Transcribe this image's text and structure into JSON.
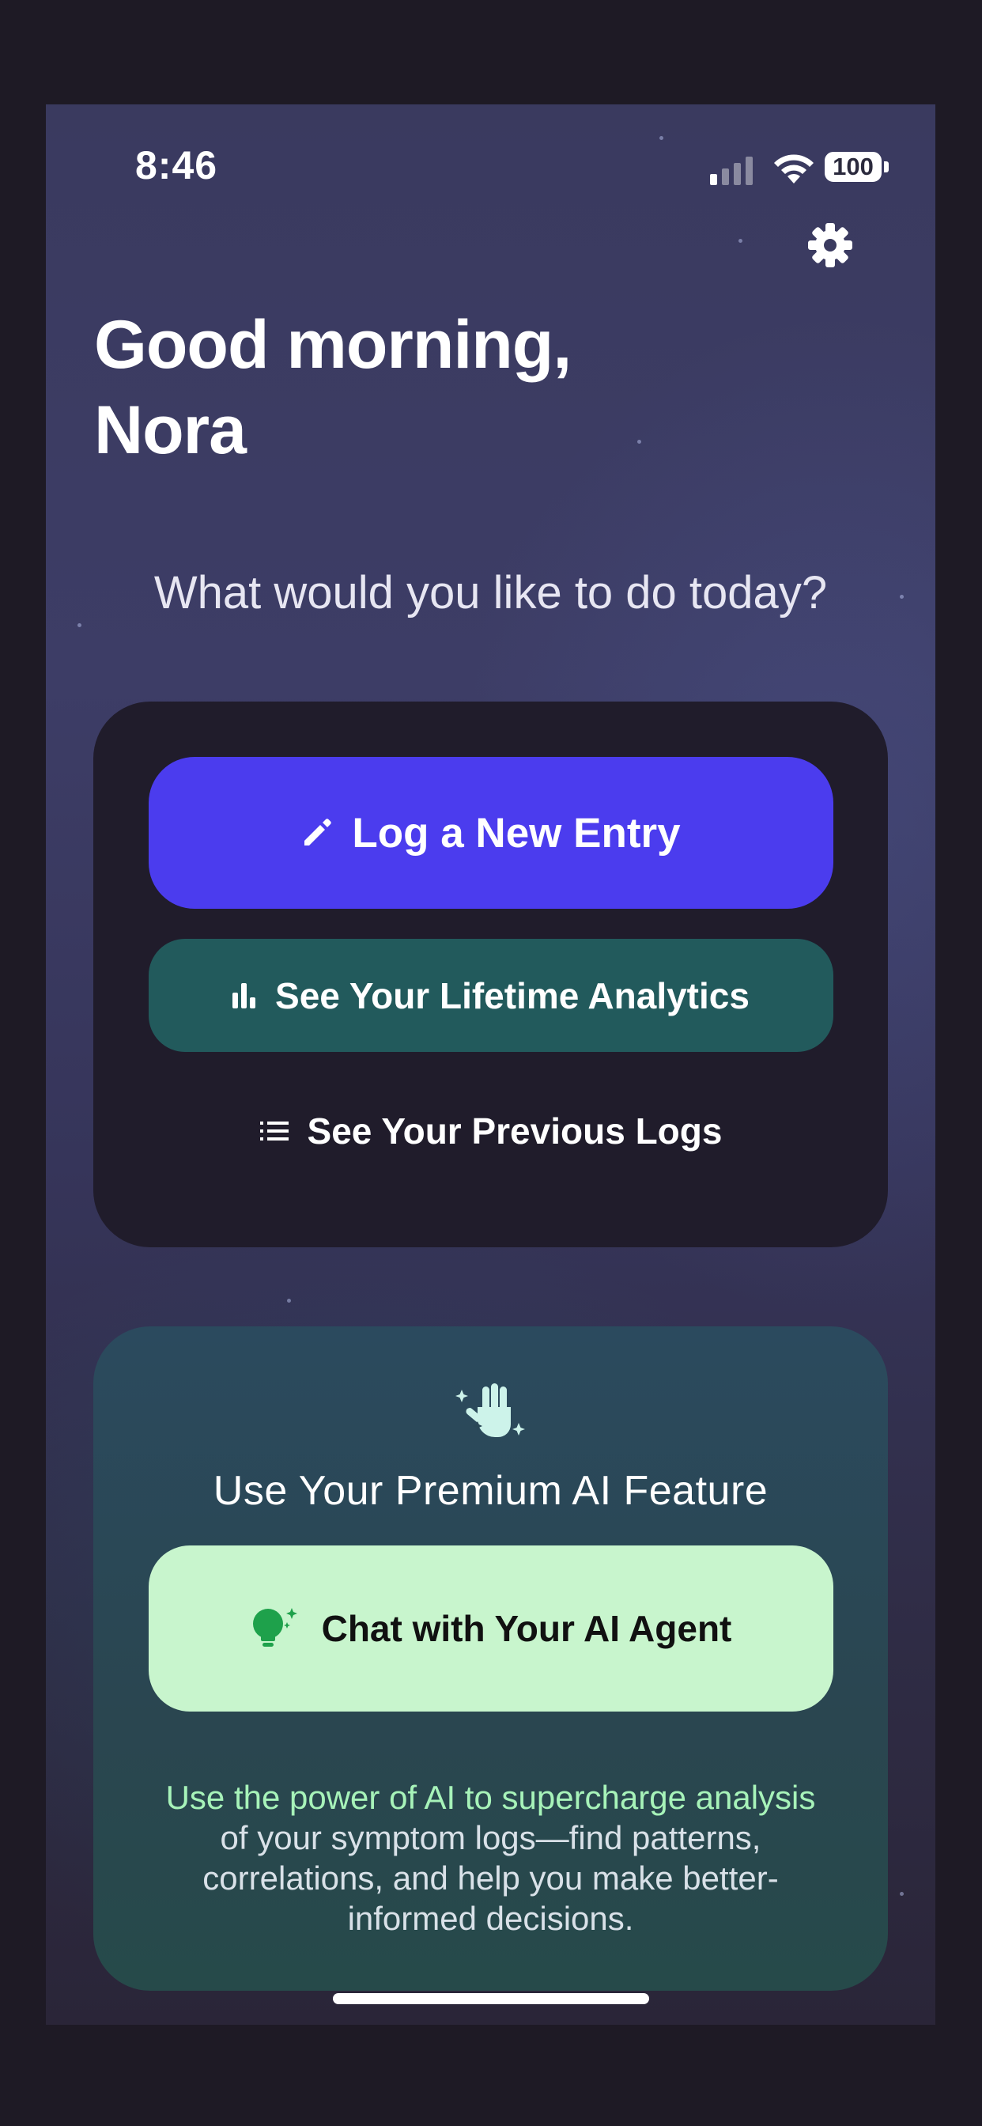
{
  "status_bar": {
    "time": "8:46",
    "battery": "100",
    "icons": [
      "cellular-signal-icon",
      "wifi-icon",
      "battery-icon"
    ]
  },
  "header": {
    "settings_icon": "gear-icon",
    "greeting_line1": "Good morning,",
    "greeting_line2": "Nora",
    "prompt": "What would you like to do today?"
  },
  "actions": {
    "log_entry": {
      "label": "Log a New Entry",
      "icon": "pencil-icon"
    },
    "analytics": {
      "label": "See Your Lifetime Analytics",
      "icon": "bar-chart-icon"
    },
    "previous_logs": {
      "label": "See Your Previous Logs",
      "icon": "list-icon"
    }
  },
  "ai_feature": {
    "icon": "sparkle-hand-icon",
    "title": "Use Your Premium AI Feature",
    "chat_button": {
      "label": "Chat with Your AI Agent",
      "icon": "lightbulb-sparkle-icon"
    },
    "description_highlight": "Use the power of AI to supercharge analysis",
    "description_rest": "of your symptom logs—find patterns, correlations, and help you make better-informed decisions."
  },
  "colors": {
    "primary": "#4b3cee",
    "teal": "#225a5c",
    "mint": "#c8f5cd",
    "highlight_text": "#a7f3b9"
  }
}
